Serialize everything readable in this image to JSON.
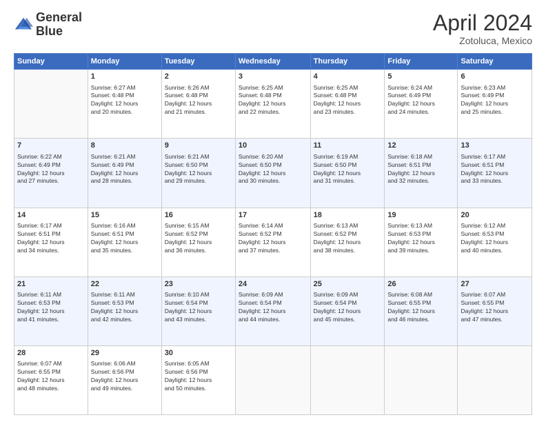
{
  "logo": {
    "line1": "General",
    "line2": "Blue"
  },
  "title": "April 2024",
  "subtitle": "Zotoluca, Mexico",
  "days_header": [
    "Sunday",
    "Monday",
    "Tuesday",
    "Wednesday",
    "Thursday",
    "Friday",
    "Saturday"
  ],
  "weeks": [
    [
      {
        "day": "",
        "info": ""
      },
      {
        "day": "1",
        "info": "Sunrise: 6:27 AM\nSunset: 6:48 PM\nDaylight: 12 hours\nand 20 minutes."
      },
      {
        "day": "2",
        "info": "Sunrise: 6:26 AM\nSunset: 6:48 PM\nDaylight: 12 hours\nand 21 minutes."
      },
      {
        "day": "3",
        "info": "Sunrise: 6:25 AM\nSunset: 6:48 PM\nDaylight: 12 hours\nand 22 minutes."
      },
      {
        "day": "4",
        "info": "Sunrise: 6:25 AM\nSunset: 6:48 PM\nDaylight: 12 hours\nand 23 minutes."
      },
      {
        "day": "5",
        "info": "Sunrise: 6:24 AM\nSunset: 6:49 PM\nDaylight: 12 hours\nand 24 minutes."
      },
      {
        "day": "6",
        "info": "Sunrise: 6:23 AM\nSunset: 6:49 PM\nDaylight: 12 hours\nand 25 minutes."
      }
    ],
    [
      {
        "day": "7",
        "info": "Sunrise: 6:22 AM\nSunset: 6:49 PM\nDaylight: 12 hours\nand 27 minutes."
      },
      {
        "day": "8",
        "info": "Sunrise: 6:21 AM\nSunset: 6:49 PM\nDaylight: 12 hours\nand 28 minutes."
      },
      {
        "day": "9",
        "info": "Sunrise: 6:21 AM\nSunset: 6:50 PM\nDaylight: 12 hours\nand 29 minutes."
      },
      {
        "day": "10",
        "info": "Sunrise: 6:20 AM\nSunset: 6:50 PM\nDaylight: 12 hours\nand 30 minutes."
      },
      {
        "day": "11",
        "info": "Sunrise: 6:19 AM\nSunset: 6:50 PM\nDaylight: 12 hours\nand 31 minutes."
      },
      {
        "day": "12",
        "info": "Sunrise: 6:18 AM\nSunset: 6:51 PM\nDaylight: 12 hours\nand 32 minutes."
      },
      {
        "day": "13",
        "info": "Sunrise: 6:17 AM\nSunset: 6:51 PM\nDaylight: 12 hours\nand 33 minutes."
      }
    ],
    [
      {
        "day": "14",
        "info": "Sunrise: 6:17 AM\nSunset: 6:51 PM\nDaylight: 12 hours\nand 34 minutes."
      },
      {
        "day": "15",
        "info": "Sunrise: 6:16 AM\nSunset: 6:51 PM\nDaylight: 12 hours\nand 35 minutes."
      },
      {
        "day": "16",
        "info": "Sunrise: 6:15 AM\nSunset: 6:52 PM\nDaylight: 12 hours\nand 36 minutes."
      },
      {
        "day": "17",
        "info": "Sunrise: 6:14 AM\nSunset: 6:52 PM\nDaylight: 12 hours\nand 37 minutes."
      },
      {
        "day": "18",
        "info": "Sunrise: 6:13 AM\nSunset: 6:52 PM\nDaylight: 12 hours\nand 38 minutes."
      },
      {
        "day": "19",
        "info": "Sunrise: 6:13 AM\nSunset: 6:53 PM\nDaylight: 12 hours\nand 39 minutes."
      },
      {
        "day": "20",
        "info": "Sunrise: 6:12 AM\nSunset: 6:53 PM\nDaylight: 12 hours\nand 40 minutes."
      }
    ],
    [
      {
        "day": "21",
        "info": "Sunrise: 6:11 AM\nSunset: 6:53 PM\nDaylight: 12 hours\nand 41 minutes."
      },
      {
        "day": "22",
        "info": "Sunrise: 6:11 AM\nSunset: 6:53 PM\nDaylight: 12 hours\nand 42 minutes."
      },
      {
        "day": "23",
        "info": "Sunrise: 6:10 AM\nSunset: 6:54 PM\nDaylight: 12 hours\nand 43 minutes."
      },
      {
        "day": "24",
        "info": "Sunrise: 6:09 AM\nSunset: 6:54 PM\nDaylight: 12 hours\nand 44 minutes."
      },
      {
        "day": "25",
        "info": "Sunrise: 6:09 AM\nSunset: 6:54 PM\nDaylight: 12 hours\nand 45 minutes."
      },
      {
        "day": "26",
        "info": "Sunrise: 6:08 AM\nSunset: 6:55 PM\nDaylight: 12 hours\nand 46 minutes."
      },
      {
        "day": "27",
        "info": "Sunrise: 6:07 AM\nSunset: 6:55 PM\nDaylight: 12 hours\nand 47 minutes."
      }
    ],
    [
      {
        "day": "28",
        "info": "Sunrise: 6:07 AM\nSunset: 6:55 PM\nDaylight: 12 hours\nand 48 minutes."
      },
      {
        "day": "29",
        "info": "Sunrise: 6:06 AM\nSunset: 6:56 PM\nDaylight: 12 hours\nand 49 minutes."
      },
      {
        "day": "30",
        "info": "Sunrise: 6:05 AM\nSunset: 6:56 PM\nDaylight: 12 hours\nand 50 minutes."
      },
      {
        "day": "",
        "info": ""
      },
      {
        "day": "",
        "info": ""
      },
      {
        "day": "",
        "info": ""
      },
      {
        "day": "",
        "info": ""
      }
    ]
  ]
}
